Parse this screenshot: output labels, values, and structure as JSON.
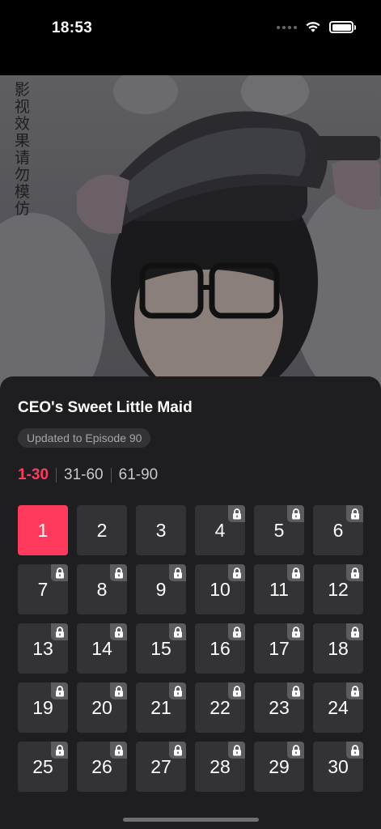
{
  "status_bar": {
    "time": "18:53"
  },
  "video": {
    "watermark": "影视效果 请勿模仿"
  },
  "drama": {
    "title": "CEO's Sweet Little Maid",
    "update_badge": "Updated to Episode 90"
  },
  "ranges": [
    {
      "label": "1-30",
      "active": true
    },
    {
      "label": "31-60",
      "active": false
    },
    {
      "label": "61-90",
      "active": false
    }
  ],
  "episodes": [
    {
      "label": "1",
      "locked": false,
      "active": true
    },
    {
      "label": "2",
      "locked": false,
      "active": false
    },
    {
      "label": "3",
      "locked": false,
      "active": false
    },
    {
      "label": "4",
      "locked": true,
      "active": false
    },
    {
      "label": "5",
      "locked": true,
      "active": false
    },
    {
      "label": "6",
      "locked": true,
      "active": false
    },
    {
      "label": "7",
      "locked": true,
      "active": false
    },
    {
      "label": "8",
      "locked": true,
      "active": false
    },
    {
      "label": "9",
      "locked": true,
      "active": false
    },
    {
      "label": "10",
      "locked": true,
      "active": false
    },
    {
      "label": "11",
      "locked": true,
      "active": false
    },
    {
      "label": "12",
      "locked": true,
      "active": false
    },
    {
      "label": "13",
      "locked": true,
      "active": false
    },
    {
      "label": "14",
      "locked": true,
      "active": false
    },
    {
      "label": "15",
      "locked": true,
      "active": false
    },
    {
      "label": "16",
      "locked": true,
      "active": false
    },
    {
      "label": "17",
      "locked": true,
      "active": false
    },
    {
      "label": "18",
      "locked": true,
      "active": false
    },
    {
      "label": "19",
      "locked": true,
      "active": false
    },
    {
      "label": "20",
      "locked": true,
      "active": false
    },
    {
      "label": "21",
      "locked": true,
      "active": false
    },
    {
      "label": "22",
      "locked": true,
      "active": false
    },
    {
      "label": "23",
      "locked": true,
      "active": false
    },
    {
      "label": "24",
      "locked": true,
      "active": false
    },
    {
      "label": "25",
      "locked": true,
      "active": false
    },
    {
      "label": "26",
      "locked": true,
      "active": false
    },
    {
      "label": "27",
      "locked": true,
      "active": false
    },
    {
      "label": "28",
      "locked": true,
      "active": false
    },
    {
      "label": "29",
      "locked": true,
      "active": false
    },
    {
      "label": "30",
      "locked": true,
      "active": false
    }
  ],
  "icons": {
    "lock": "lock-icon",
    "wifi": "wifi-icon",
    "battery": "battery-icon",
    "signal": "cellular-signal-icon"
  },
  "colors": {
    "accent": "#ff3a5c",
    "sheet": "#1e1e20",
    "tile": "#333336"
  }
}
